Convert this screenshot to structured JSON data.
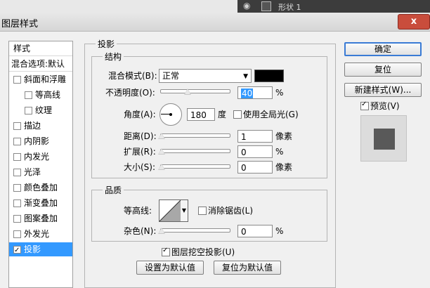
{
  "background_panel": {
    "layer_name": "形状 1"
  },
  "window": {
    "title": "图层样式",
    "close_glyph": "x"
  },
  "styles": {
    "header": "样式",
    "blend_default": "混合选项:默认",
    "items": [
      {
        "label": "斜面和浮雕",
        "checked": false,
        "indent": false
      },
      {
        "label": "等高线",
        "checked": false,
        "indent": true
      },
      {
        "label": "纹理",
        "checked": false,
        "indent": true
      },
      {
        "label": "描边",
        "checked": false,
        "indent": false
      },
      {
        "label": "内阴影",
        "checked": false,
        "indent": false
      },
      {
        "label": "内发光",
        "checked": false,
        "indent": false
      },
      {
        "label": "光泽",
        "checked": false,
        "indent": false
      },
      {
        "label": "颜色叠加",
        "checked": false,
        "indent": false
      },
      {
        "label": "渐变叠加",
        "checked": false,
        "indent": false
      },
      {
        "label": "图案叠加",
        "checked": false,
        "indent": false
      },
      {
        "label": "外发光",
        "checked": false,
        "indent": false
      },
      {
        "label": "投影",
        "checked": true,
        "indent": false
      }
    ]
  },
  "drop_shadow": {
    "group_title": "投影",
    "structure": {
      "title": "结构",
      "blend_mode_label": "混合模式(B):",
      "blend_mode_value": "正常",
      "shadow_color": "#000000",
      "opacity_label": "不透明度(O):",
      "opacity_value": "40",
      "opacity_unit": "%",
      "opacity_fraction": 0.4,
      "angle_label": "角度(A):",
      "angle_value": "180",
      "angle_unit": "度",
      "global_light_label": "使用全局光(G)",
      "global_light_checked": false,
      "distance_label": "距离(D):",
      "distance_value": "1",
      "distance_unit": "像素",
      "spread_label": "扩展(R):",
      "spread_value": "0",
      "spread_unit": "%",
      "size_label": "大小(S):",
      "size_value": "0",
      "size_unit": "像素"
    },
    "quality": {
      "title": "品质",
      "contour_label": "等高线:",
      "antialias_label": "消除锯齿(L)",
      "antialias_checked": false,
      "noise_label": "杂色(N):",
      "noise_value": "0",
      "noise_unit": "%"
    },
    "knockout_label": "图层挖空投影(U)",
    "knockout_checked": true,
    "make_default_label": "设置为默认值",
    "reset_default_label": "复位为默认值"
  },
  "actions": {
    "ok_label": "确定",
    "reset_label": "复位",
    "new_style_label": "新建样式(W)...",
    "preview_label": "预览(V)",
    "preview_checked": true
  },
  "colors": {
    "selection": "#3399ff",
    "preview_square": "#595959"
  }
}
